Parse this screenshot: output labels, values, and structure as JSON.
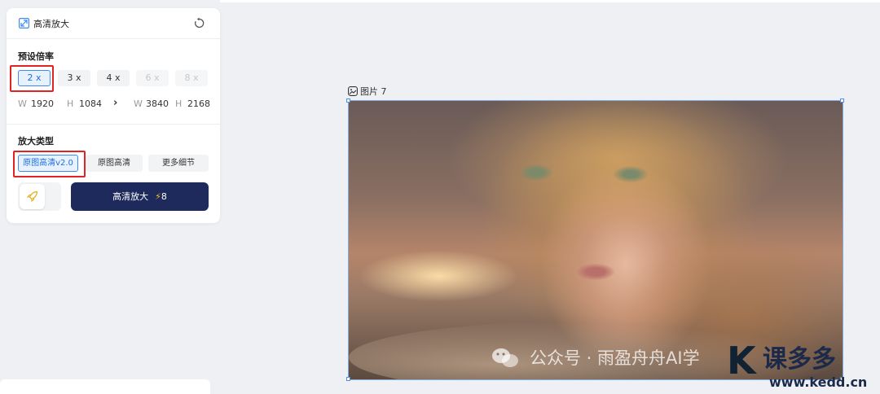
{
  "panel": {
    "title": "高清放大",
    "icons": {
      "title": "expand-icon",
      "reset": "reset-icon"
    },
    "preset_section": "预设倍率",
    "scales": [
      {
        "label": "2 x",
        "state": "selected"
      },
      {
        "label": "3 x",
        "state": "normal"
      },
      {
        "label": "4 x",
        "state": "normal"
      },
      {
        "label": "6 x",
        "state": "disabled"
      },
      {
        "label": "8 x",
        "state": "disabled"
      }
    ],
    "original": {
      "w_label": "W",
      "w": "1920",
      "h_label": "H",
      "h": "1084"
    },
    "arrow": "›",
    "target": {
      "w_label": "W",
      "w": "3840",
      "h_label": "H",
      "h": "2168"
    },
    "type_section": "放大类型",
    "types": [
      {
        "label": "原图高清v2.0",
        "state": "selected"
      },
      {
        "label": "原图高清",
        "state": "normal"
      },
      {
        "label": "更多细节",
        "state": "normal"
      }
    ],
    "action": {
      "label": "高清放大",
      "cost": "8",
      "cost_icon": "bolt-icon",
      "fav_icon": "rocket-icon"
    }
  },
  "canvas": {
    "layer_label": "图片 7",
    "layer_icon": "image-icon"
  },
  "watermark": {
    "text": "公众号 · 雨盈舟舟AI学",
    "icon": "wechat-icon"
  },
  "logo": {
    "mark": "K",
    "text": "课多多",
    "url": "www.kedd.cn"
  },
  "colors": {
    "accent": "#3d8bf2",
    "primary_button": "#1e2a5c",
    "highlight_box": "#e02424",
    "bolt": "#f5c026"
  }
}
